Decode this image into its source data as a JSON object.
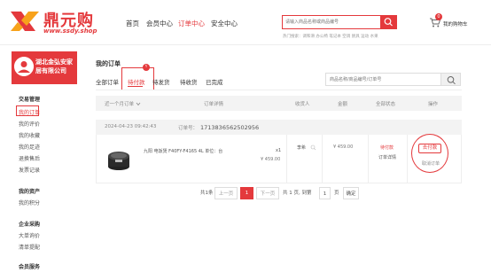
{
  "brand": {
    "name": "鼎元购",
    "url": "www.ssdy.shop"
  },
  "nav": {
    "home": "首页",
    "member": "会员中心",
    "orders": "订单中心",
    "security": "安全中心"
  },
  "search": {
    "placeholder": "请输入商品名称或商品编号",
    "hot_label": "热门搜索：",
    "hot_words": "调和滑 办公椅 笔记本 空调 厨具 运动 水果"
  },
  "cart": {
    "label": "我的购物车",
    "count": "0"
  },
  "sidebar": {
    "company": "湖北金弘安家居有限公司",
    "sections": [
      {
        "title": "交易管理",
        "items": [
          "我的订单",
          "我的评价",
          "我的收藏",
          "我的足迹",
          "退换售后",
          "发票记录"
        ]
      },
      {
        "title": "我的资产",
        "items": [
          "我的积分"
        ]
      },
      {
        "title": "企业采购",
        "items": [
          "大单询价",
          "清单提配"
        ]
      },
      {
        "title": "会员服务",
        "items": []
      }
    ]
  },
  "main": {
    "title": "我的订单",
    "tabs": [
      "全部订单",
      "待付款",
      "待发货",
      "待收货",
      "已完成"
    ],
    "tab_badge": "1",
    "order_search_placeholder": "商品名称/商品编号/订单号",
    "table_headers": {
      "period": "近一个月订单",
      "detail": "订单详情",
      "receiver": "收货人",
      "amount": "金额",
      "status": "全部状态",
      "action": "操作"
    },
    "order": {
      "time": "2024-04-23 09:42:43",
      "id_label": "订单号：",
      "id": "1713836562502956",
      "product_name": "九阳 电饭煲 F40FY-F4165 4L 单位：台",
      "qty": "x1",
      "unit_price": "¥ 459.00",
      "buyer": "李希",
      "amount": "¥ 459.00",
      "status": "待付款",
      "status_detail": "订单详情",
      "pay_label": "去付款",
      "cancel_label": "取消订单"
    },
    "pager": {
      "total": "共1条",
      "prev": "上一页",
      "current": "1",
      "next": "下一页",
      "pages": "共 1 页, 到第",
      "page_input": "1",
      "page_unit": "页",
      "confirm": "确定"
    }
  },
  "colors": {
    "accent": "#e4393c"
  }
}
